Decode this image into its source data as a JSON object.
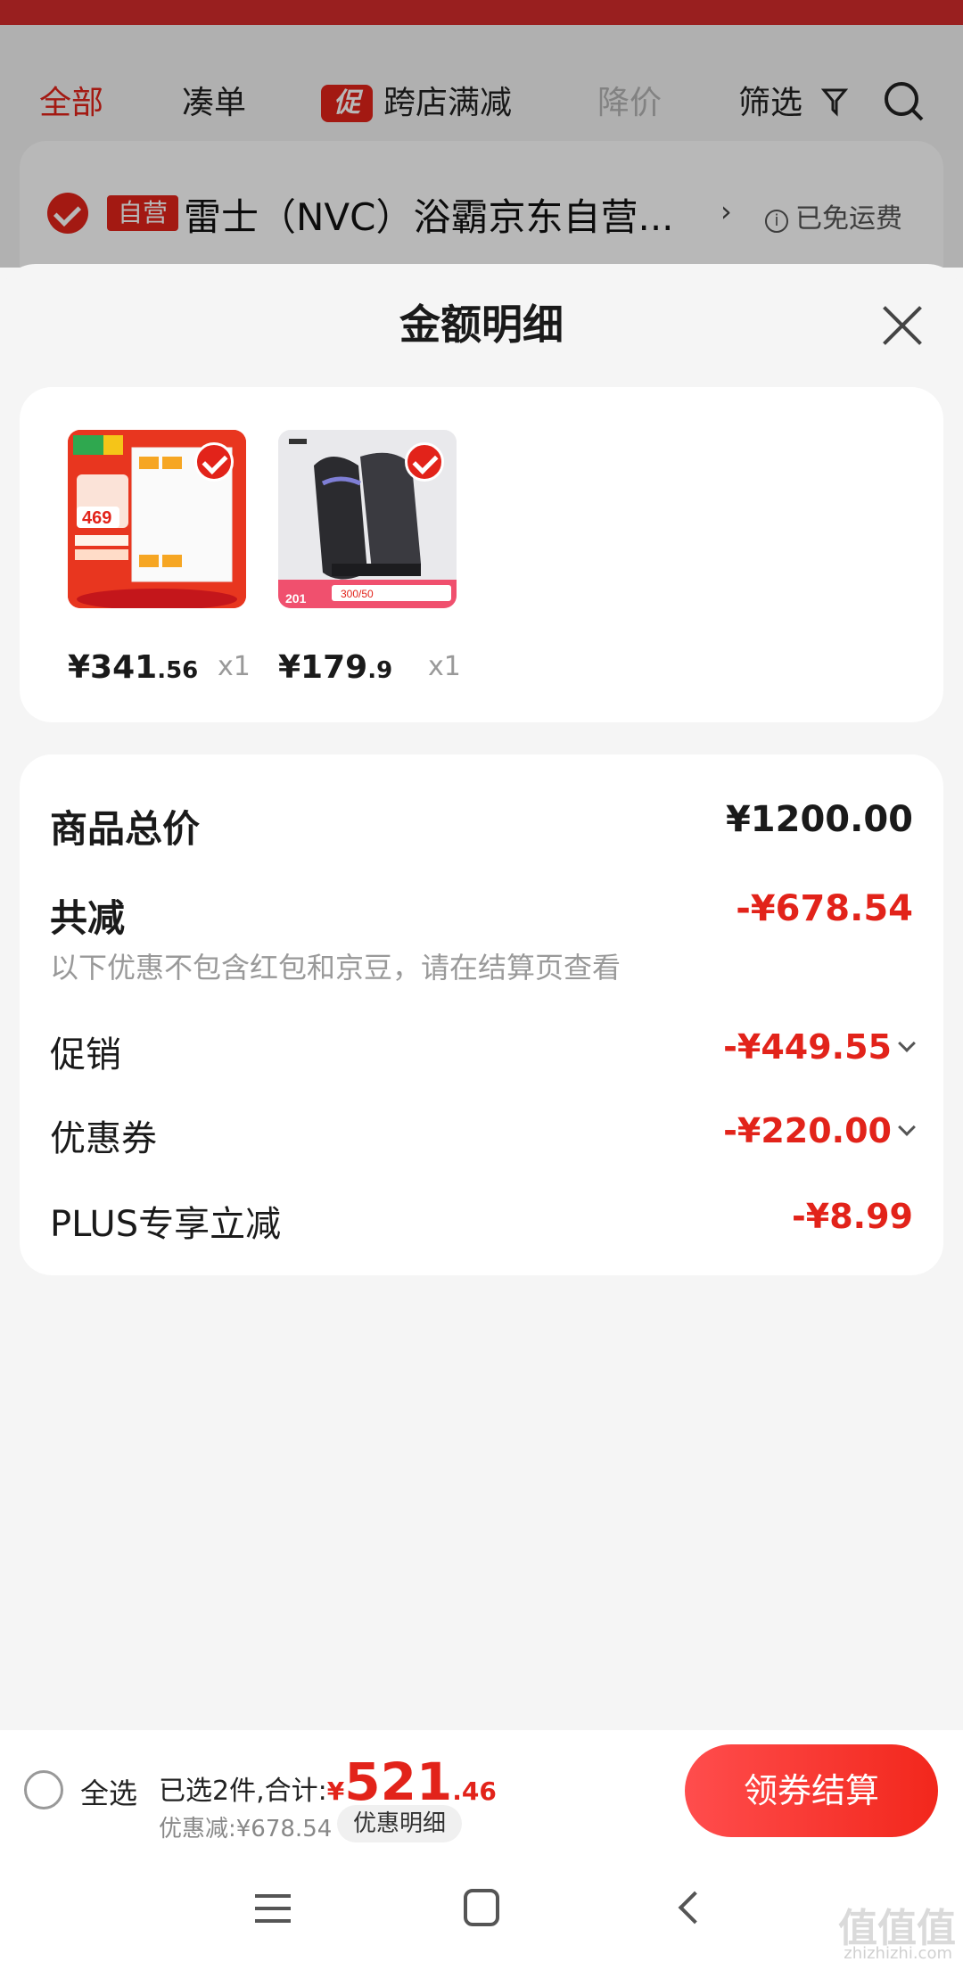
{
  "background": {
    "tabs": [
      {
        "label": "全部",
        "state": "active"
      },
      {
        "label": "凑单",
        "state": "normal"
      },
      {
        "label": "跨店满减",
        "state": "normal",
        "tag": "促"
      },
      {
        "label": "降价",
        "state": "muted"
      },
      {
        "label": "筛选",
        "state": "normal"
      }
    ],
    "store": {
      "tag": "自营",
      "name": "雷士（NVC）浴霸京东自营...",
      "shipping": "已免运费"
    }
  },
  "sheet": {
    "title": "金额明细",
    "products": [
      {
        "price_main": "¥341",
        "price_dec": ".56",
        "qty": "x1",
        "checked": true
      },
      {
        "price_main": "¥179",
        "price_dec": ".9",
        "qty": "x1",
        "checked": true
      }
    ],
    "summary": {
      "total_label": "商品总价",
      "total_value": "¥1200.00",
      "reduce_label": "共减",
      "reduce_value": "-¥678.54",
      "note": "以下优惠不包含红包和京豆，请在结算页查看",
      "items": [
        {
          "label": "促销",
          "value": "-¥449.55",
          "expandable": true
        },
        {
          "label": "优惠券",
          "value": "-¥220.00",
          "expandable": true
        },
        {
          "label": "PLUS专享立减",
          "value": "-¥8.99",
          "expandable": false
        }
      ]
    }
  },
  "bottom_bar": {
    "select_all": "全选",
    "selected_prefix": "已选2件,合计:",
    "currency": "¥",
    "total_int": "521",
    "total_dec": ".46",
    "discount": "优惠减:¥678.54",
    "detail_chip": "优惠明细",
    "checkout": "领券结算"
  },
  "watermark": {
    "main": "值值值",
    "sub": "zhizhizhi.com"
  },
  "colors": {
    "accent": "#e2231a",
    "checkout_gradient_start": "#ff4d4d"
  }
}
